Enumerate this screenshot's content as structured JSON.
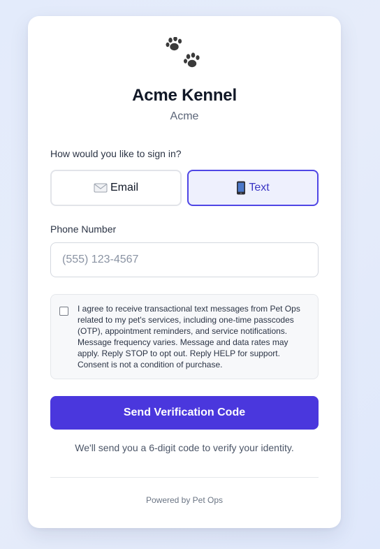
{
  "app": {
    "logo_icon": "paw-prints-icon",
    "title": "Acme Kennel",
    "subtitle": "Acme"
  },
  "sign_in": {
    "question": "How would you like to sign in?",
    "methods": [
      {
        "label": "Email",
        "icon": "envelope-icon",
        "selected": false
      },
      {
        "label": "Text",
        "icon": "mobile-phone-icon",
        "selected": true
      }
    ]
  },
  "phone": {
    "label": "Phone Number",
    "value": "",
    "placeholder": "(555) 123-4567"
  },
  "consent": {
    "checked": false,
    "text": "I agree to receive transactional text messages from Pet Ops related to my pet's services, including one-time passcodes (OTP), appointment reminders, and service notifications. Message frequency varies. Message and data rates may apply. Reply STOP to opt out. Reply HELP for support. Consent is not a condition of purchase."
  },
  "submit": {
    "label": "Send Verification Code"
  },
  "hint": "We'll send you a 6-digit code to verify your identity.",
  "footer": "Powered by Pet Ops",
  "colors": {
    "accent": "#4a37dd",
    "selected_border": "#4f46e5",
    "selected_bg": "#eef0fd"
  }
}
